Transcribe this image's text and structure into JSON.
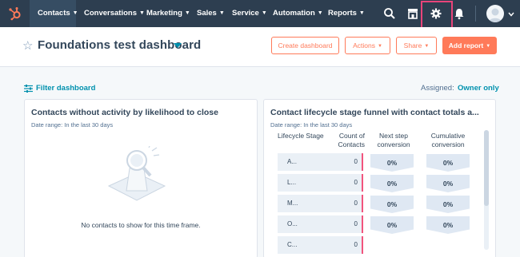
{
  "nav": {
    "items": [
      "Contacts",
      "Conversations",
      "Marketing",
      "Sales",
      "Service",
      "Automation",
      "Reports"
    ],
    "active": "Contacts"
  },
  "header": {
    "title": "Foundations test dashboard",
    "buttons": {
      "create": "Create dashboard",
      "actions": "Actions",
      "share": "Share",
      "add_report": "Add report"
    }
  },
  "filter": {
    "label": "Filter dashboard",
    "assigned_label": "Assigned:",
    "assigned_value": "Owner only"
  },
  "card1": {
    "title": "Contacts without activity by likelihood to close",
    "date_range": "Date range: In the last 30 days",
    "empty_text": "No contacts to show for this time frame."
  },
  "card2": {
    "title": "Contact lifecycle stage funnel with contact totals a...",
    "date_range": "Date range: In the last 30 days",
    "columns": {
      "stage": "Lifecycle Stage",
      "count": "Count of Contacts",
      "next": "Next step conversion",
      "cumulative": "Cumulative conversion"
    },
    "rows": [
      {
        "stage": "A...",
        "count": "0",
        "next": "0%",
        "cumulative": "0%"
      },
      {
        "stage": "L...",
        "count": "0",
        "next": "0%",
        "cumulative": "0%"
      },
      {
        "stage": "M...",
        "count": "0",
        "next": "0%",
        "cumulative": "0%"
      },
      {
        "stage": "O...",
        "count": "0",
        "next": "0%",
        "cumulative": "0%"
      },
      {
        "stage": "C...",
        "count": "0",
        "next": "",
        "cumulative": ""
      }
    ]
  },
  "colors": {
    "nav_bg": "#2d3e50",
    "accent_orange": "#ff7a59",
    "link_teal": "#0091ae",
    "highlight_pink": "#e8447a"
  }
}
